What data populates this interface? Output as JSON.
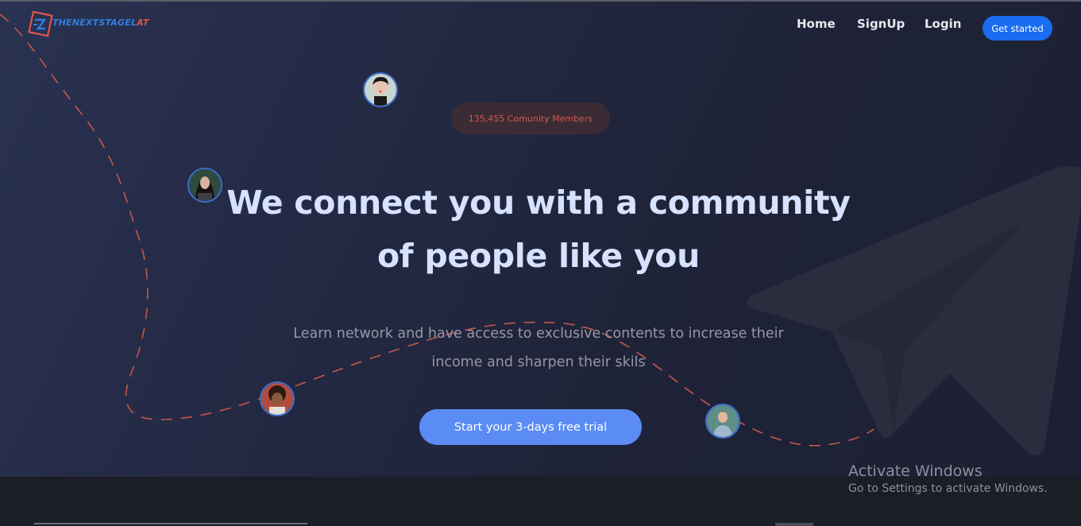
{
  "brand": {
    "logo_text": "THENEXTSTAGEL",
    "logo_accent": "AT",
    "primary_color": "#1a6cf0",
    "accent_color": "#e0554a"
  },
  "nav": {
    "home": "Home",
    "signup": "SignUp",
    "login": "Login",
    "get_started": "Get started"
  },
  "hero": {
    "badge": "135,455 Comunity Members",
    "headline_line1": "We connect you with a community",
    "headline_line2": "of people like you",
    "sub_line1": "Learn network and have access to exclusive contents to increase their",
    "sub_line2": "income and sharpen their skils",
    "cta": "Start your 3-days free trial"
  },
  "icons": {
    "background": "paper-plane-icon"
  },
  "os_watermark": {
    "title": "Activate Windows",
    "subtitle": "Go to Settings to activate Windows."
  }
}
